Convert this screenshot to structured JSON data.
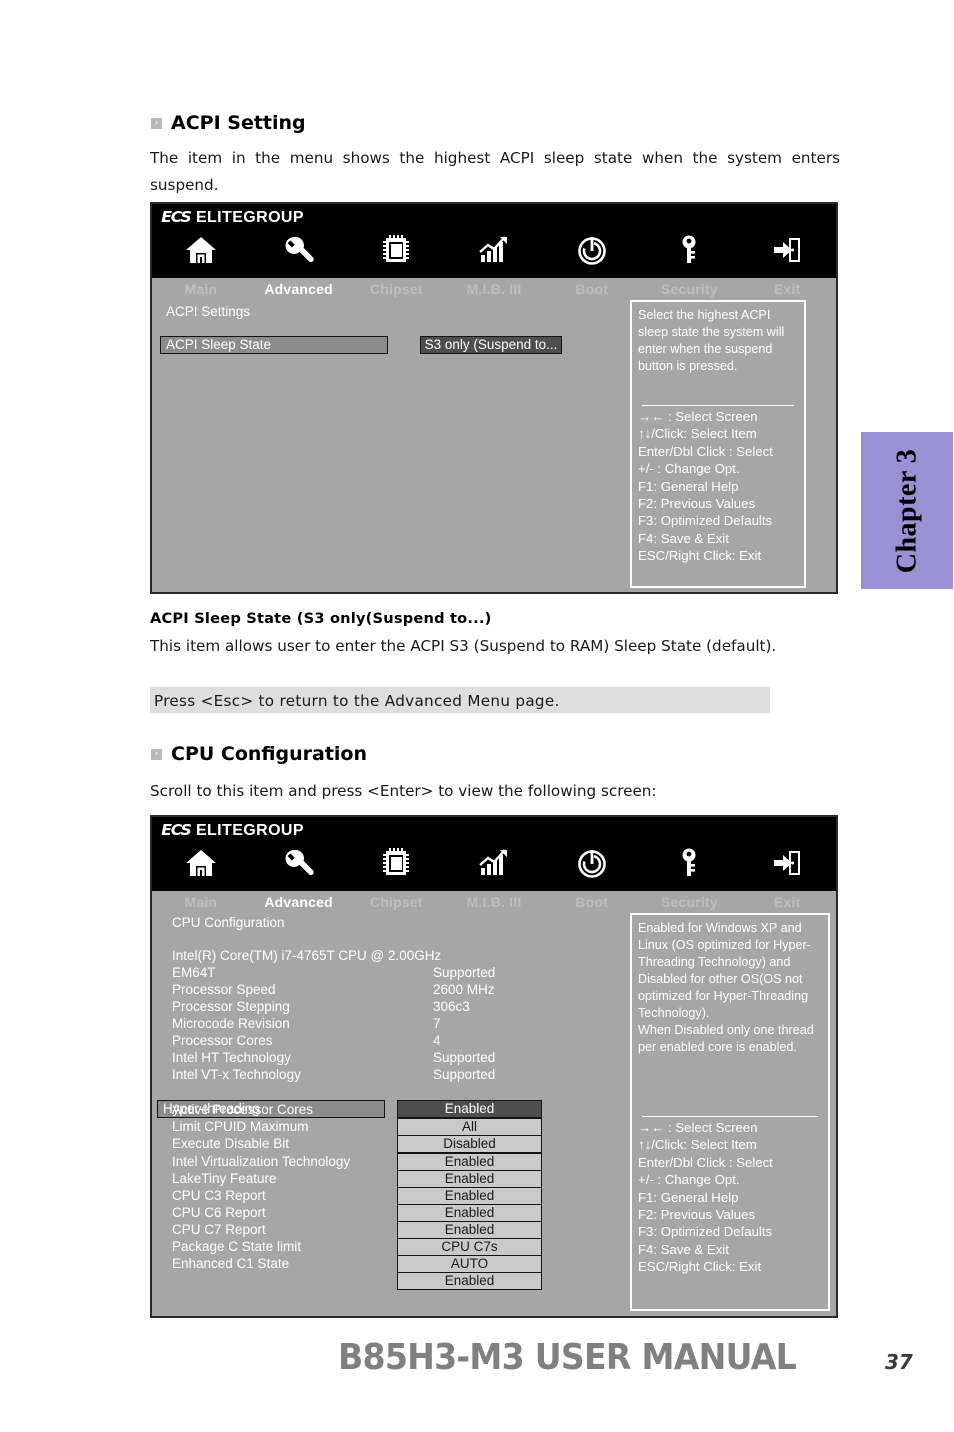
{
  "page": {
    "footer_title": "B85H3-M3 USER MANUAL",
    "footer_page": "37",
    "chapter_tab": "Chapter 3"
  },
  "bullet_glyph": "›",
  "sections": {
    "acpi": {
      "heading": "ACPI Setting",
      "intro": "The item in the menu shows the highest ACPI sleep state when the system enters suspend.",
      "subheading": "ACPI Sleep State (S3 only(Suspend to...)",
      "description": "This item allows user to enter the ACPI S3 (Suspend to RAM) Sleep State (default).",
      "note": "Press <Esc> to return to the Advanced Menu page."
    },
    "cpu": {
      "heading": "CPU Configuration",
      "intro": "Scroll to this item and press <Enter> to view the following screen:"
    }
  },
  "bios": {
    "brand_mark": "ECS",
    "brand_word": "ELITEGROUP",
    "nav": [
      {
        "label": "Main",
        "icon": "home-icon",
        "active": false
      },
      {
        "label": "Advanced",
        "icon": "wrench-icon",
        "active": true
      },
      {
        "label": "Chipset",
        "icon": "chip-icon",
        "active": false
      },
      {
        "label": "M.I.B. III",
        "icon": "chart-icon",
        "active": false
      },
      {
        "label": "Boot",
        "icon": "power-icon",
        "active": false
      },
      {
        "label": "Security",
        "icon": "key-icon",
        "active": false
      },
      {
        "label": "Exit",
        "icon": "exit-door-icon",
        "active": false
      }
    ],
    "help_keys": "→←  : Select Screen\n↑↓/Click: Select Item\nEnter/Dbl Click : Select\n+/- : Change Opt.\nF1: General Help\nF2: Previous Values\nF3: Optimized Defaults\nF4: Save & Exit\nESC/Right Click: Exit"
  },
  "screen_acpi": {
    "section_title": "ACPI Settings",
    "row_label": "ACPI Sleep State",
    "row_value": "S3 only (Suspend to...",
    "help": "Select the highest ACPI sleep state the system will enter when the suspend button is pressed."
  },
  "screen_cpu": {
    "section_title": "CPU Configuration",
    "cpu_model": "Intel(R) Core(TM) i7-4765T CPU @  2.00GHz",
    "info_rows": [
      {
        "label": "EM64T",
        "value": "Supported"
      },
      {
        "label": "Processor Speed",
        "value": "2600 MHz"
      },
      {
        "label": "Processor Stepping",
        "value": "306c3"
      },
      {
        "label": "Microcode Revision",
        "value": "7"
      },
      {
        "label": "Processor Cores",
        "value": "4"
      },
      {
        "label": "Intel HT Technology",
        "value": "Supported"
      },
      {
        "label": "Intel VT-x Technology",
        "value": "Supported"
      }
    ],
    "setting_rows": [
      {
        "label": "Hyper-threading",
        "value": "Enabled",
        "selected": true
      },
      {
        "label": "Active Processor Cores",
        "value": "All",
        "selected": false
      },
      {
        "label": "Limit CPUID Maximum",
        "value": "Disabled",
        "selected": false
      },
      {
        "label": "Execute Disable Bit",
        "value": "Enabled",
        "selected": false
      },
      {
        "label": "Intel Virtualization Technology",
        "value": "Enabled",
        "selected": false
      },
      {
        "label": "LakeTiny Feature",
        "value": "Enabled",
        "selected": false
      },
      {
        "label": "CPU C3 Report",
        "value": "Enabled",
        "selected": false
      },
      {
        "label": "CPU C6 Report",
        "value": "Enabled",
        "selected": false
      },
      {
        "label": "CPU C7 Report",
        "value": "CPU C7s",
        "selected": false
      },
      {
        "label": "Package C State limit",
        "value": "AUTO",
        "selected": false
      },
      {
        "label": "Enhanced C1 State",
        "value": "Enabled",
        "selected": false
      }
    ],
    "help": "Enabled for Windows XP and Linux (OS optimized for Hyper-Threading Technology) and Disabled for other OS(OS not optimized for Hyper-Threading Technology).\nWhen Disabled only one thread per enabled core is enabled."
  },
  "colors": {
    "bios_bg": "#a6a6a6",
    "bios_header": "#000000",
    "accent_tab": "#9a90d4",
    "note_band": "#dededf",
    "value_chip_light": "#c9c9c9",
    "value_chip_dark": "#4e4e4e"
  }
}
